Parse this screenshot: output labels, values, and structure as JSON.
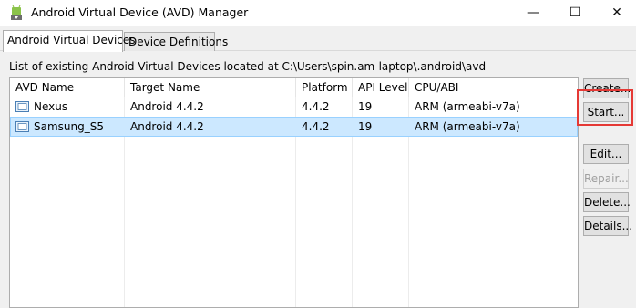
{
  "window": {
    "title": "Android Virtual Device (AVD) Manager",
    "minimize_glyph": "—",
    "maximize_glyph": "☐",
    "close_glyph": "✕"
  },
  "tabs": [
    {
      "label": "Android Virtual Devices",
      "active": true
    },
    {
      "label": "Device Definitions",
      "active": false
    }
  ],
  "list_label": "List of existing Android Virtual Devices located at C:\\Users\\spin.am-laptop\\.android\\avd",
  "table": {
    "columns": [
      "AVD Name",
      "Target Name",
      "Platform",
      "API Level",
      "CPU/ABI"
    ],
    "rows": [
      {
        "name": "Nexus",
        "target": "Android 4.4.2",
        "platform": "4.4.2",
        "api": "19",
        "cpu": "ARM (armeabi-v7a)",
        "selected": false
      },
      {
        "name": "Samsung_S5",
        "target": "Android 4.4.2",
        "platform": "4.4.2",
        "api": "19",
        "cpu": "ARM (armeabi-v7a)",
        "selected": true
      }
    ]
  },
  "buttons": {
    "create": "Create...",
    "start": "Start...",
    "edit": "Edit...",
    "repair": "Repair...",
    "delete": "Delete...",
    "details": "Details..."
  },
  "colors": {
    "selection": "#cce8ff",
    "highlight": "#e53935",
    "android_green": "#8bc34a"
  }
}
